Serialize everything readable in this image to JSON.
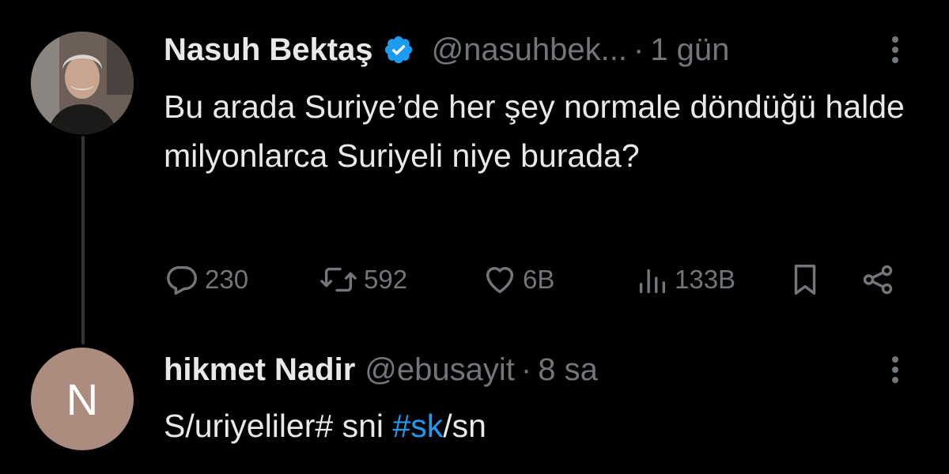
{
  "tweets": [
    {
      "author_name": "Nasuh Bektaş",
      "verified": true,
      "handle": "@nasuhbek...",
      "separator": "·",
      "time": "1 gün",
      "text": "Bu arada Suriye’de her şey normale döndüğü halde milyonlarca Suriyeli niye burada?",
      "avatar": "profile-photo",
      "stats": {
        "replies": "230",
        "reposts": "592",
        "likes": "6B",
        "views": "133B"
      }
    },
    {
      "author_name": "hikmet Nadir",
      "verified": false,
      "handle": "@ebusayit",
      "separator": "·",
      "time": "8 sa",
      "avatar_initial": "N",
      "text_parts": [
        "S/uriyeliler# sni ",
        "#sk",
        "/sn"
      ]
    }
  ],
  "icons": {
    "reply": "comment-bubble-icon",
    "repost": "repost-arrows-icon",
    "like": "heart-icon",
    "views": "bar-chart-icon",
    "bookmark": "bookmark-icon",
    "share": "share-icon",
    "more": "more-vertical-icon",
    "verified": "verified-badge-icon"
  },
  "colors": {
    "background": "#000000",
    "text_primary": "#e7e9ea",
    "text_secondary": "#71767b",
    "accent": "#1d9bf0",
    "avatar_initial_bg": "#ad8c80",
    "thread_line": "#333639"
  }
}
